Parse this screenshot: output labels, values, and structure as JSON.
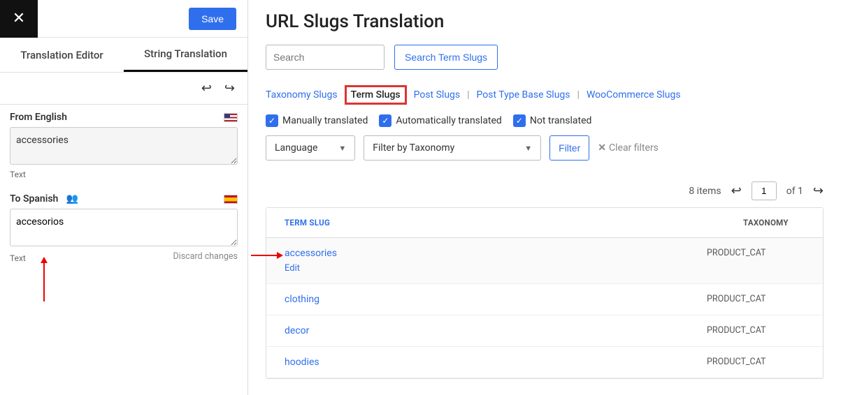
{
  "topbar": {
    "save_label": "Save"
  },
  "tabs": {
    "editor": "Translation Editor",
    "string": "String Translation"
  },
  "from": {
    "label": "From English",
    "value": "accessories",
    "type": "Text"
  },
  "to": {
    "label": "To Spanish",
    "value": "accesorios",
    "type": "Text",
    "discard": "Discard changes"
  },
  "main": {
    "title": "URL Slugs Translation",
    "search_placeholder": "Search",
    "search_btn": "Search Term Slugs",
    "slug_tabs": {
      "taxonomy": "Taxonomy Slugs",
      "term": "Term Slugs",
      "post": "Post Slugs",
      "post_type": "Post Type Base Slugs",
      "woo": "WooCommerce Slugs"
    },
    "filters": {
      "manual": "Manually translated",
      "auto": "Automatically translated",
      "not": "Not translated",
      "language": "Language",
      "taxonomy": "Filter by Taxonomy",
      "filter_btn": "Filter",
      "clear": "Clear filters"
    },
    "pager": {
      "items": "8 items",
      "page": "1",
      "of": "of 1"
    },
    "table": {
      "col_slug": "TERM SLUG",
      "col_tax": "TAXONOMY",
      "edit": "Edit",
      "rows": [
        {
          "slug": "accessories",
          "tax": "PRODUCT_CAT"
        },
        {
          "slug": "clothing",
          "tax": "PRODUCT_CAT"
        },
        {
          "slug": "decor",
          "tax": "PRODUCT_CAT"
        },
        {
          "slug": "hoodies",
          "tax": "PRODUCT_CAT"
        }
      ]
    }
  }
}
